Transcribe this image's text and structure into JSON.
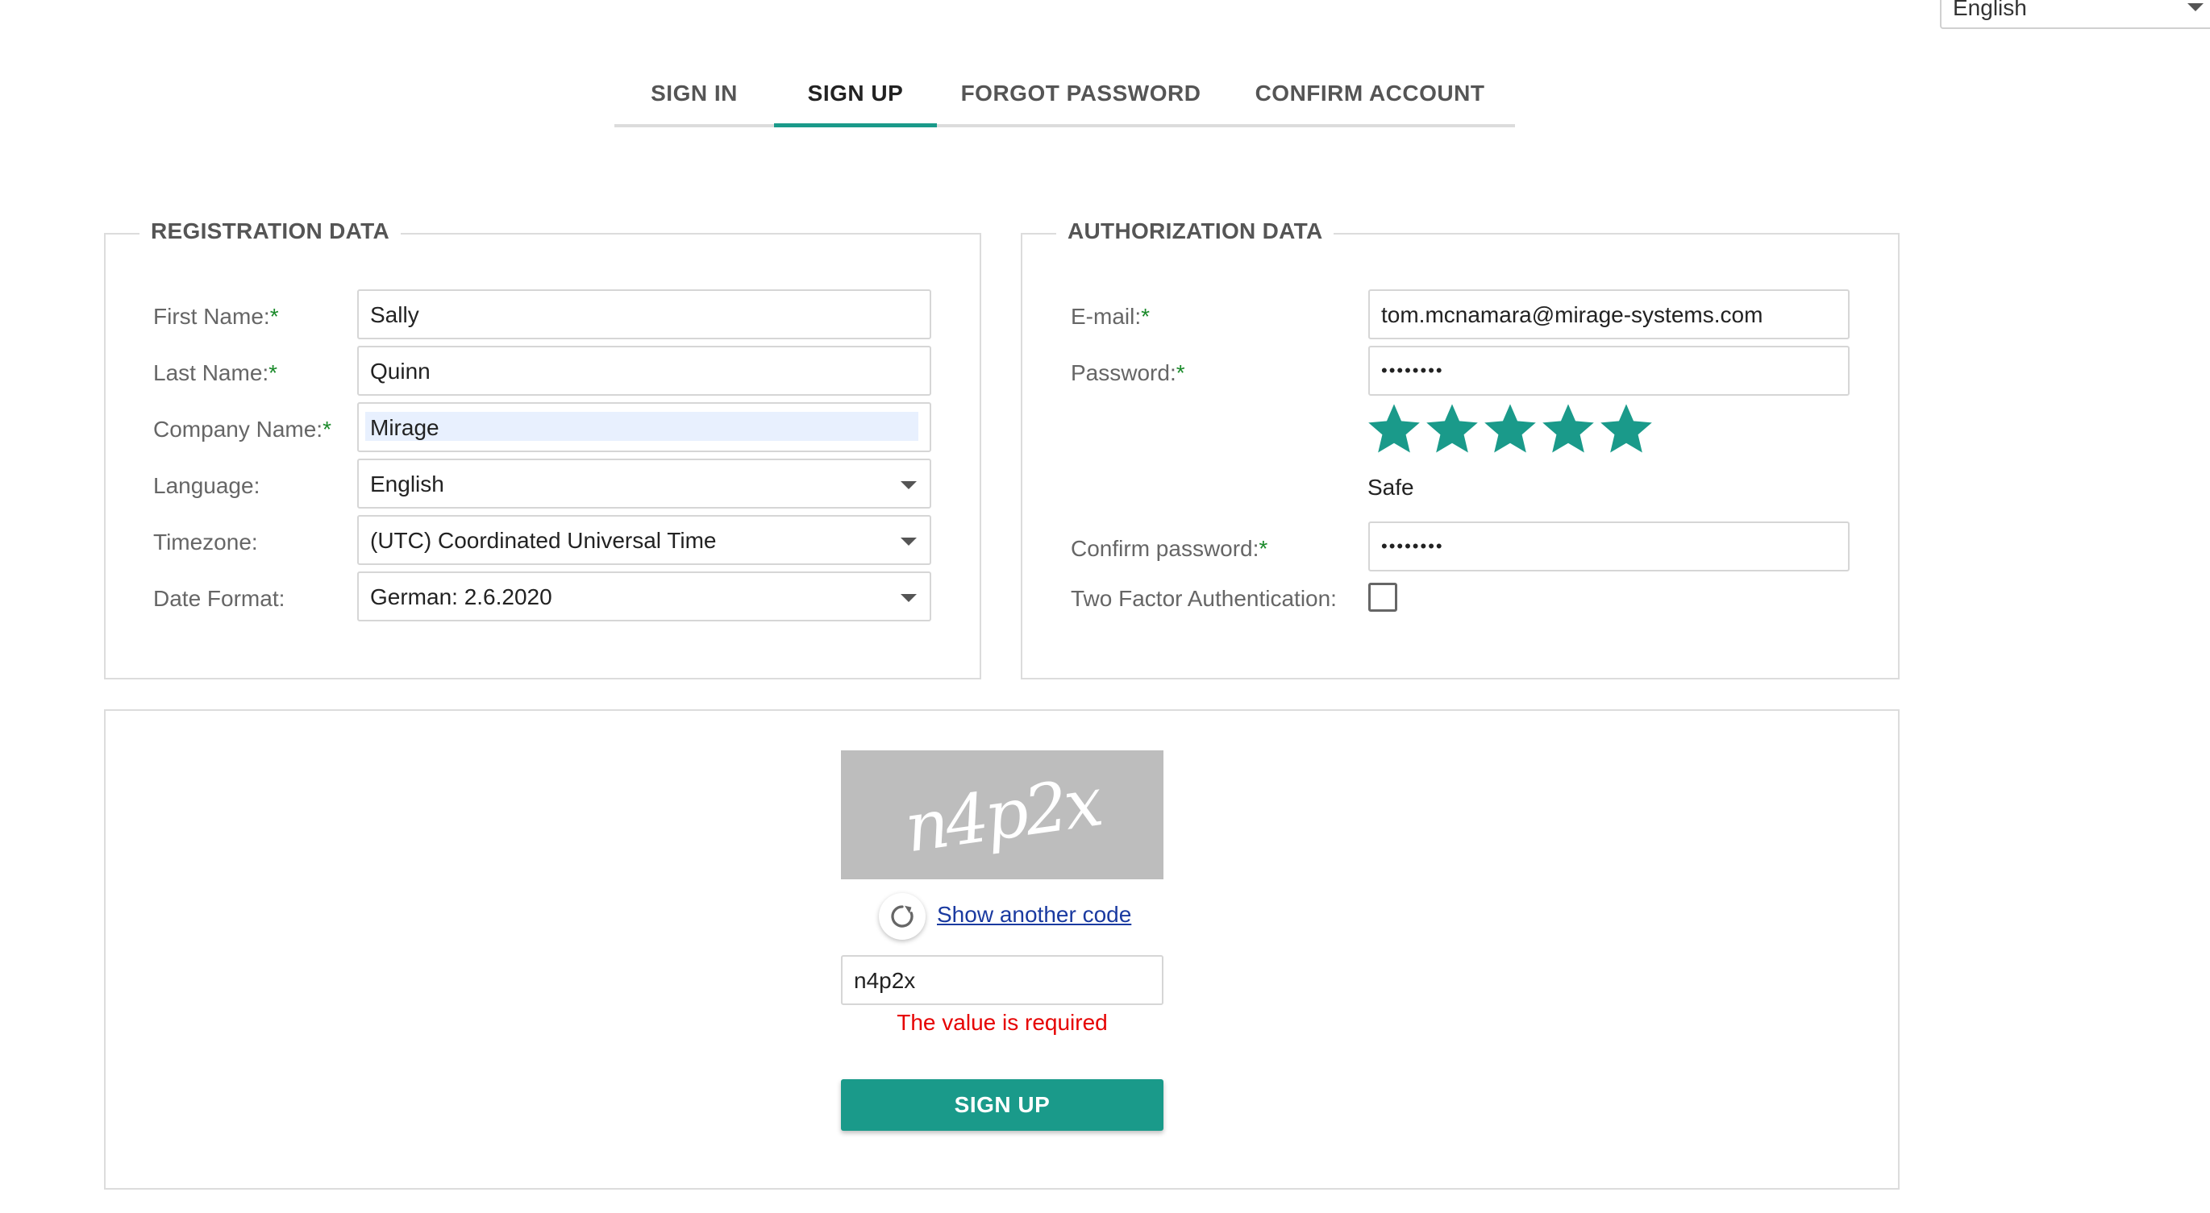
{
  "top_language": {
    "value": "English"
  },
  "tabs": [
    {
      "label": "SIGN IN"
    },
    {
      "label": "SIGN UP"
    },
    {
      "label": "FORGOT PASSWORD"
    },
    {
      "label": "CONFIRM ACCOUNT"
    }
  ],
  "active_tab": "SIGN UP",
  "registration": {
    "legend": "REGISTRATION DATA",
    "first_name": {
      "label": "First Name:",
      "required": "*",
      "value": "Sally"
    },
    "last_name": {
      "label": "Last Name:",
      "required": "*",
      "value": "Quinn"
    },
    "company_name": {
      "label": "Company Name:",
      "required": "*",
      "value": "Mirage"
    },
    "language": {
      "label": "Language:",
      "value": "English"
    },
    "timezone": {
      "label": "Timezone:",
      "value": "(UTC) Coordinated Universal Time"
    },
    "date_format": {
      "label": "Date Format:",
      "value": "German: 2.6.2020"
    }
  },
  "authorization": {
    "legend": "AUTHORIZATION DATA",
    "email": {
      "label": "E-mail:",
      "required": "*",
      "value": "tom.mcnamara@mirage-systems.com"
    },
    "password": {
      "label": "Password:",
      "required": "*",
      "value": "••••••••"
    },
    "strength": {
      "stars": 5,
      "max_stars": 5,
      "label": "Safe"
    },
    "confirm_password": {
      "label": "Confirm password:",
      "required": "*",
      "value": "••••••••"
    },
    "two_factor": {
      "label": "Two Factor Authentication:",
      "checked": false
    }
  },
  "captcha": {
    "image_text": "n4p2x",
    "refresh_link": "Show another code",
    "input_value": "n4p2x",
    "error": "The value is required",
    "submit_label": "SIGN UP"
  },
  "colors": {
    "accent": "#1a9a8a",
    "required": "#1a8a2a",
    "error": "#e60000",
    "link": "#1a3aa0"
  }
}
